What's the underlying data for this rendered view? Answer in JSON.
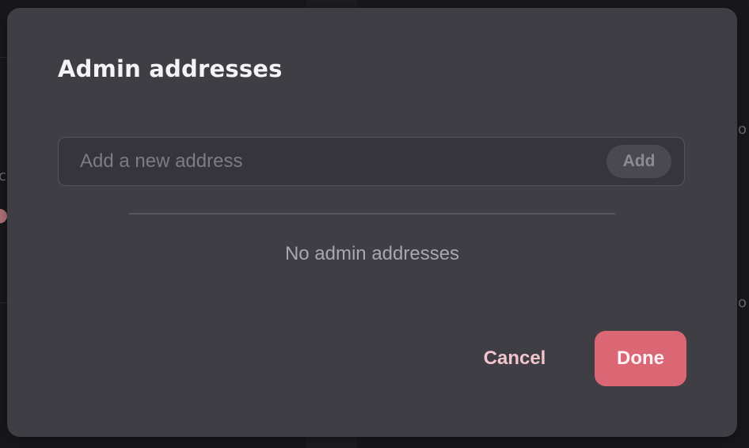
{
  "dialog": {
    "title": "Admin addresses",
    "input": {
      "placeholder": "Add a new address",
      "value": ""
    },
    "add_label": "Add",
    "empty_message": "No admin addresses",
    "cancel_label": "Cancel",
    "done_label": "Done"
  },
  "colors": {
    "accent": "#db6674",
    "dialog_background": "#3f3e44",
    "cancel_text": "#f2c4cc"
  }
}
